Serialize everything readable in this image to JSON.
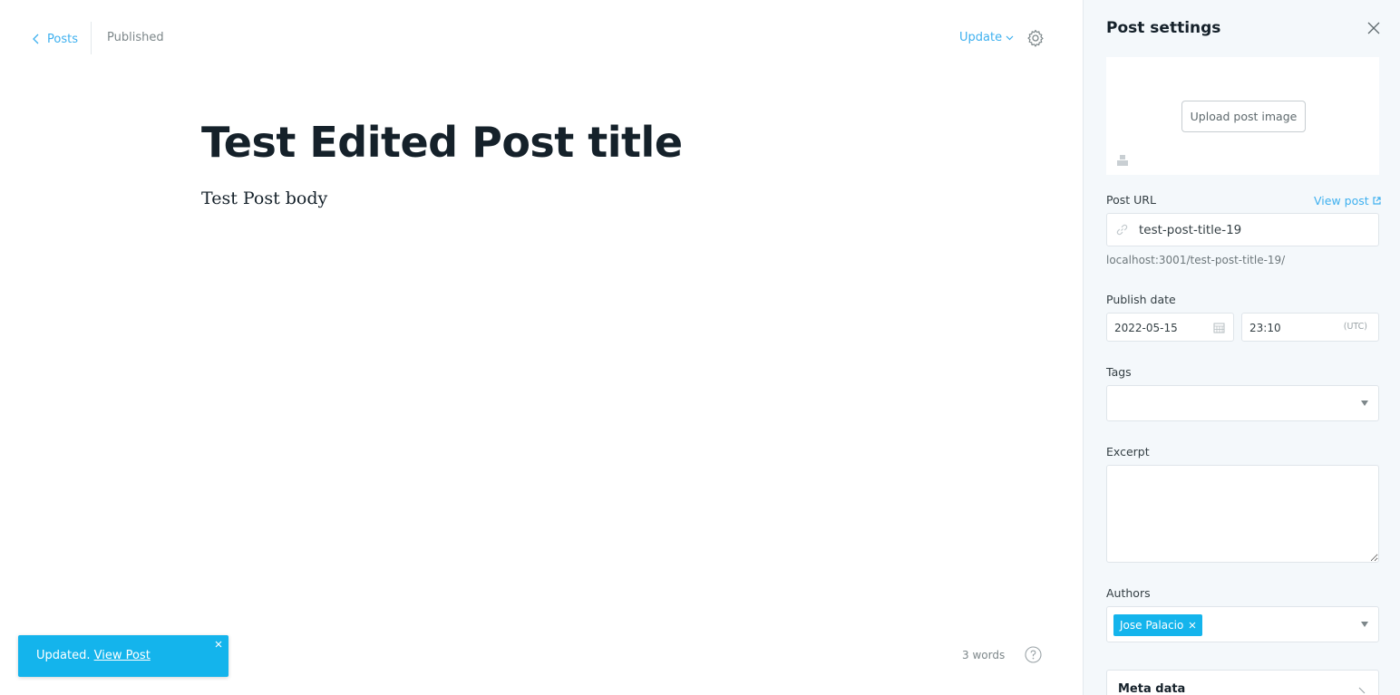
{
  "header": {
    "back_label": "Posts",
    "status": "Published",
    "update_label": "Update"
  },
  "editor": {
    "title": "Test Edited Post title",
    "body": "Test Post body",
    "word_count": "3 words"
  },
  "toast": {
    "message": "Updated.",
    "link": "View Post"
  },
  "settings": {
    "title": "Post settings",
    "upload_label": "Upload post image",
    "post_url_label": "Post URL",
    "view_post_label": "View post",
    "slug": "test-post-title-19",
    "url_hint": "localhost:3001/test-post-title-19/",
    "publish_date_label": "Publish date",
    "date": "2022-05-15",
    "time": "23:10",
    "timezone": "(UTC)",
    "tags_label": "Tags",
    "excerpt_label": "Excerpt",
    "excerpt": "",
    "authors_label": "Authors",
    "authors": [
      "Jose Palacio"
    ],
    "meta_data_label": "Meta data"
  },
  "colors": {
    "accent": "#3eb0ef",
    "toast": "#14b4ec",
    "panel_bg": "#f4f8fb"
  }
}
